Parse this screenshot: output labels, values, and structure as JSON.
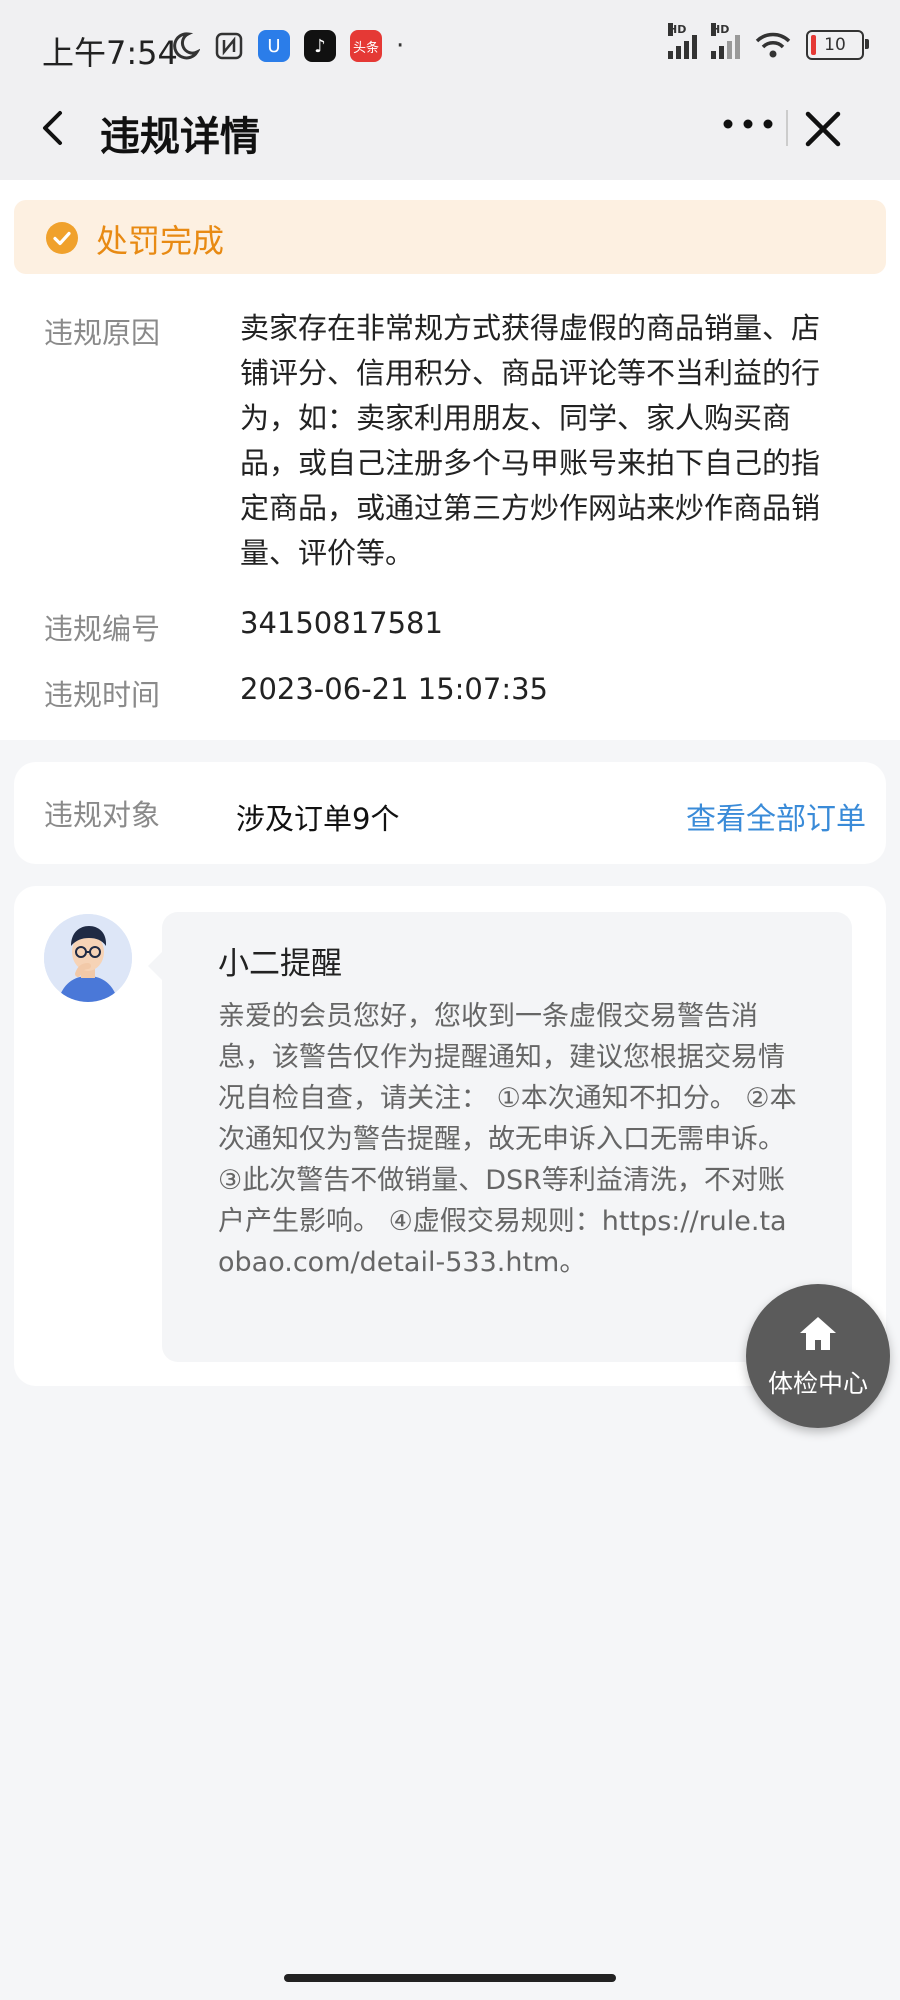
{
  "status_bar": {
    "time": "上午7:54",
    "app_badge": "头条",
    "dot": "·",
    "hd": "HD",
    "battery": "10"
  },
  "header": {
    "title": "违规详情"
  },
  "penalty_status": "处罚完成",
  "details": {
    "reason_label": "违规原因",
    "reason_value": "卖家存在非常规方式获得虚假的商品销量、店铺评分、信用积分、商品评论等不当利益的行为，如：卖家利用朋友、同学、家人购买商品，或自己注册多个马甲账号来拍下自己的指定商品，或通过第三方炒作网站来炒作商品销量、评价等。",
    "number_label": "违规编号",
    "number_value": "34150817581",
    "time_label": "违规时间",
    "time_value": "2023-06-21 15:07:35"
  },
  "target": {
    "label": "违规对象",
    "value": "涉及订单9个",
    "link": "查看全部订单"
  },
  "message": {
    "title": "小二提醒",
    "body": "亲爱的会员您好，您收到一条虚假交易警告消息，该警告仅作为提醒通知，建议您根据交易情况自检自查，请关注： ①本次通知不扣分。 ②本次通知仅为警告提醒，故无申诉入口无需申诉。 ③此次警告不做销量、DSR等利益清洗，不对账户产生影响。 ④虚假交易规则：https://rule.taobao.com/detail-533.htm。"
  },
  "fab": {
    "label": "体检中心"
  },
  "colors": {
    "accent_orange": "#e88a13",
    "banner_bg": "#fdf0e1",
    "link_blue": "#3a8bd8"
  }
}
